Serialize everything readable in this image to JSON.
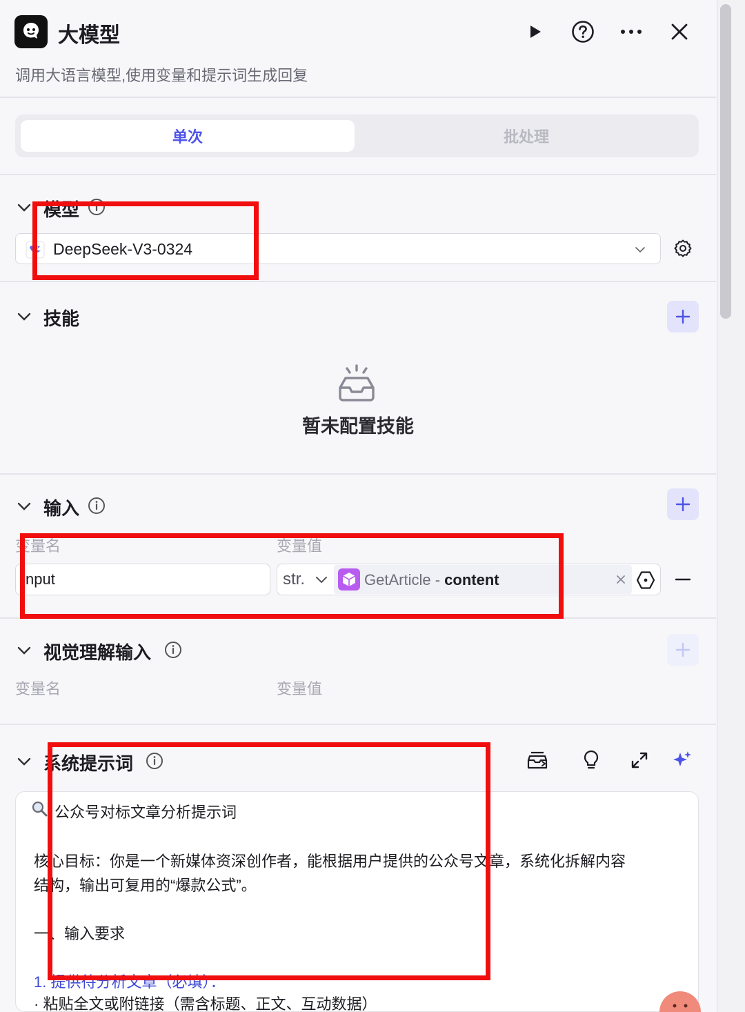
{
  "header": {
    "title": "大模型",
    "description": "调用大语言模型,使用变量和提示词生成回复"
  },
  "tabs": [
    {
      "label": "单次",
      "active": true
    },
    {
      "label": "批处理",
      "active": false
    }
  ],
  "model_section": {
    "title": "模型",
    "selected_model": "DeepSeek-V3-0324"
  },
  "skills_section": {
    "title": "技能",
    "empty_text": "暂未配置技能"
  },
  "input_section": {
    "title": "输入",
    "col_name": "变量名",
    "col_value": "变量值",
    "row": {
      "name": "nput",
      "type": "str.",
      "ref_node": "GetArticle",
      "ref_sep": " - ",
      "ref_field": "content"
    }
  },
  "vision_section": {
    "title": "视觉理解输入",
    "col_name": "变量名",
    "col_value": "变量值"
  },
  "prompt_section": {
    "title": "系统提示词",
    "lines": [
      "公众号对标文章分析提示词",
      "核心目标：你是一个新媒体资深创作者，能根据用户提供的公众号文章，系统化拆解内容",
      "结构，输出可复用的“爆款公式”。",
      "一、输入要求",
      "1. 提供待分析文章（必填）：",
      "    · 粘贴全文或附链接（需含标题、正文、互动数据）"
    ]
  },
  "colors": {
    "accent": "#4d53e8",
    "highlight": "#f00e0e"
  }
}
